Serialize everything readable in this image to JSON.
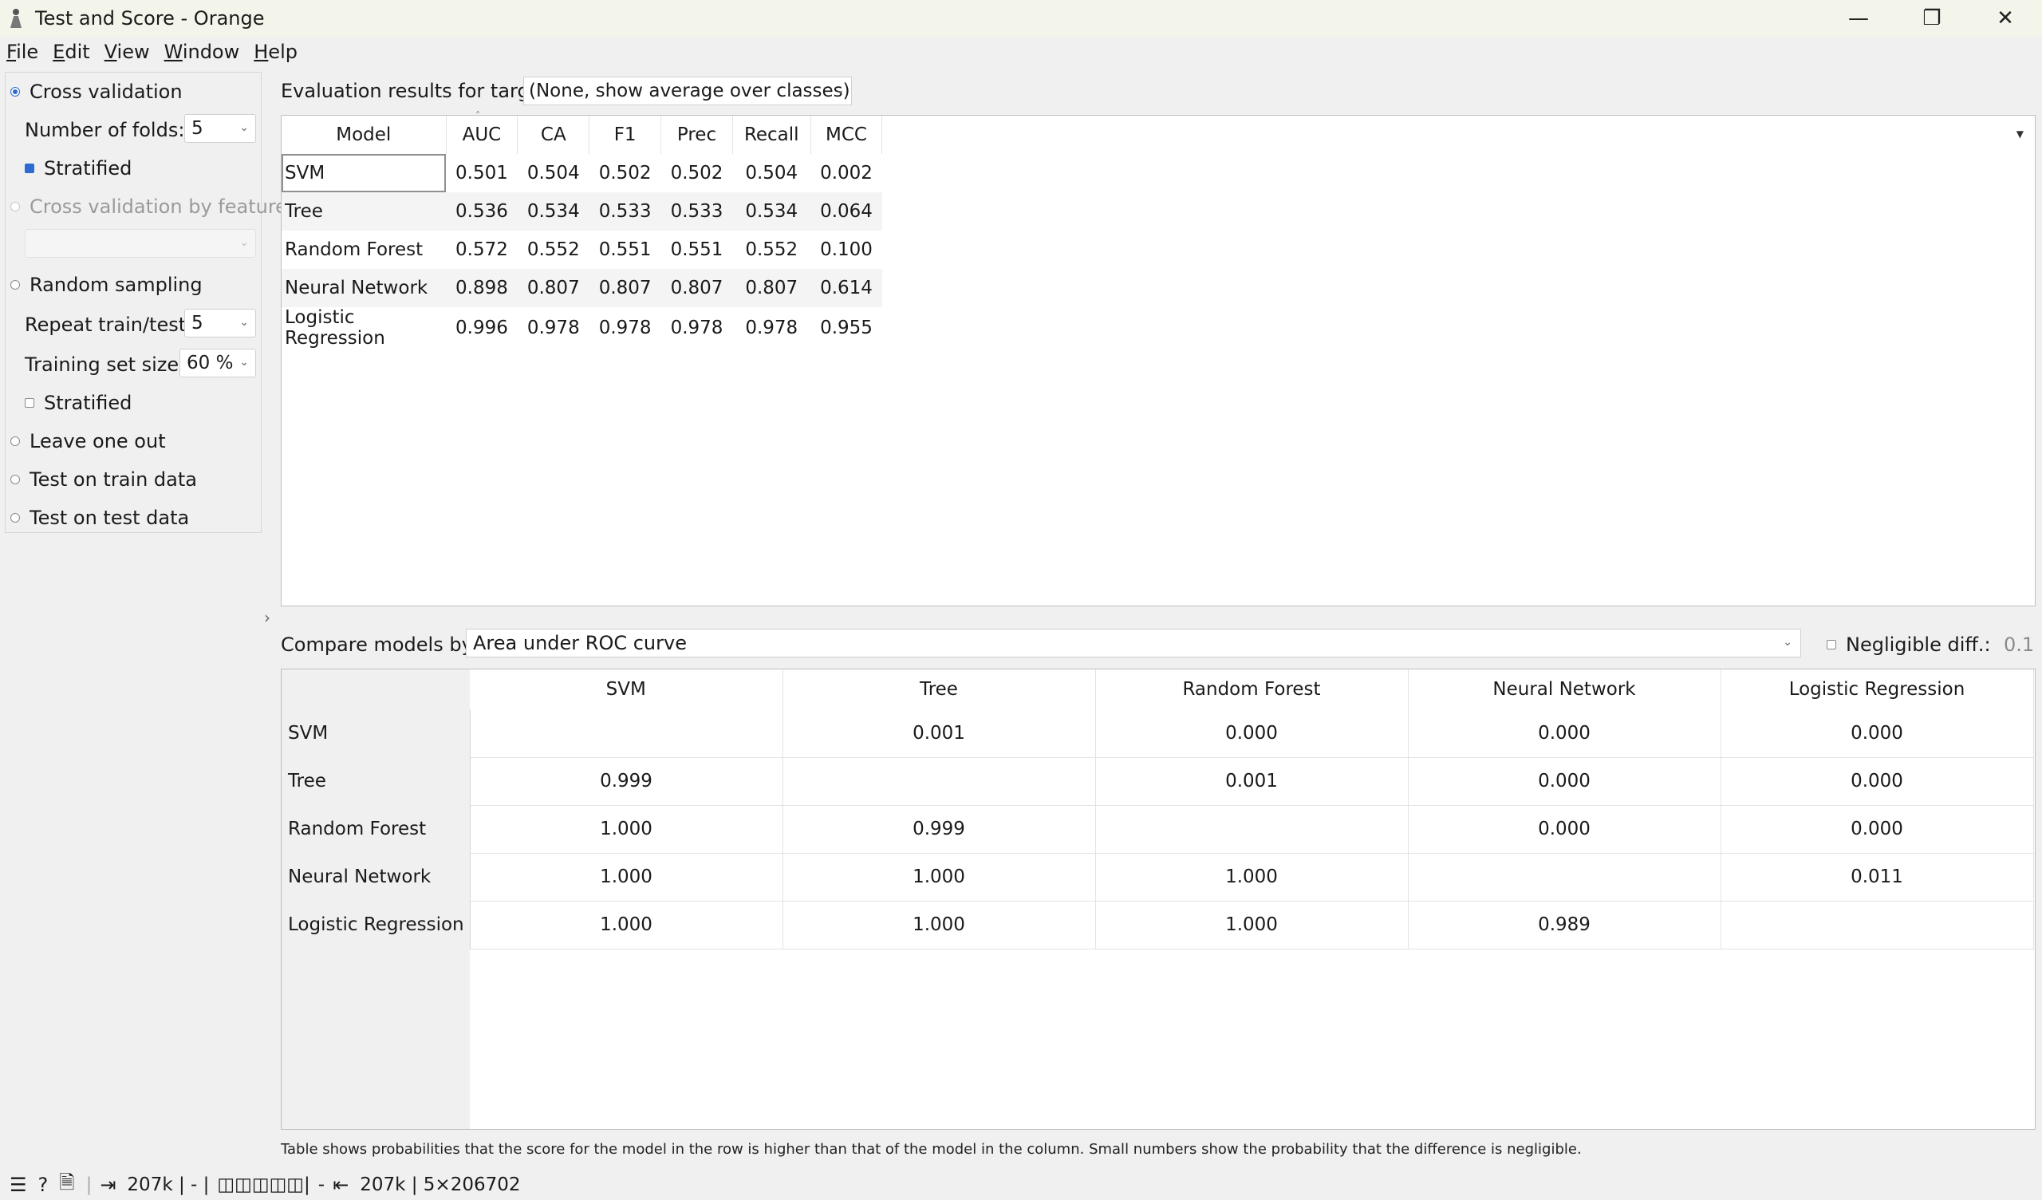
{
  "window": {
    "title": "Test and Score - Orange",
    "minimize": "—",
    "maximize": "❐",
    "close": "✕"
  },
  "menu": [
    {
      "u": "F",
      "rest": "ile"
    },
    {
      "u": "E",
      "rest": "dit"
    },
    {
      "u": "V",
      "rest": "iew"
    },
    {
      "u": "W",
      "rest": "indow"
    },
    {
      "u": "H",
      "rest": "elp"
    }
  ],
  "sampling": {
    "cross_validation": "Cross validation",
    "folds_label": "Number of folds:",
    "folds_value": "5",
    "stratified_label": "Stratified",
    "cv_by_feature": "Cross validation by feature",
    "feature_value": "",
    "random_sampling": "Random sampling",
    "repeat_label": "Repeat train/test:",
    "repeat_value": "5",
    "train_size_label": "Training set size:",
    "train_size_value": "60 %",
    "stratified2_label": "Stratified",
    "leave_one_out": "Leave one out",
    "test_on_train": "Test on train data",
    "test_on_test": "Test on test data"
  },
  "evaluation": {
    "target_label": "Evaluation results for target",
    "target_value": "(None, show average over classes)",
    "columns": [
      "Model",
      "AUC",
      "CA",
      "F1",
      "Prec",
      "Recall",
      "MCC"
    ],
    "rows": [
      [
        "SVM",
        "0.501",
        "0.504",
        "0.502",
        "0.502",
        "0.504",
        "0.002"
      ],
      [
        "Tree",
        "0.536",
        "0.534",
        "0.533",
        "0.533",
        "0.534",
        "0.064"
      ],
      [
        "Random Forest",
        "0.572",
        "0.552",
        "0.551",
        "0.551",
        "0.552",
        "0.100"
      ],
      [
        "Neural Network",
        "0.898",
        "0.807",
        "0.807",
        "0.807",
        "0.807",
        "0.614"
      ],
      [
        "Logistic Regression",
        "0.996",
        "0.978",
        "0.978",
        "0.978",
        "0.978",
        "0.955"
      ]
    ]
  },
  "compare": {
    "label": "Compare models by:",
    "metric": "Area under ROC curve",
    "negligible_label": "Negligible diff.:",
    "negligible_value": "0.1",
    "columns": [
      "SVM",
      "Tree",
      "Random Forest",
      "Neural Network",
      "Logistic Regression"
    ],
    "rows": [
      {
        "name": "SVM",
        "cells": [
          "",
          "0.001",
          "0.000",
          "0.000",
          "0.000"
        ]
      },
      {
        "name": "Tree",
        "cells": [
          "0.999",
          "",
          "0.001",
          "0.000",
          "0.000"
        ]
      },
      {
        "name": "Random Forest",
        "cells": [
          "1.000",
          "0.999",
          "",
          "0.000",
          "0.000"
        ]
      },
      {
        "name": "Neural Network",
        "cells": [
          "1.000",
          "1.000",
          "1.000",
          "",
          "0.011"
        ]
      },
      {
        "name": "Logistic Regression",
        "cells": [
          "1.000",
          "1.000",
          "1.000",
          "0.989",
          ""
        ]
      }
    ],
    "footnote": "Table shows probabilities that the score for the model in the row is higher than that of the model in the column. Small numbers show the probability that the difference is negligible."
  },
  "status": {
    "input_size": "207k | - |",
    "input_slots": "◫◫◫◫◫|",
    "separator": "-",
    "output_size": "207k | 5×206702"
  },
  "icons": {
    "menu": "☰",
    "help": "?",
    "report": "🗎",
    "input": "⇥",
    "output": "⇤"
  }
}
